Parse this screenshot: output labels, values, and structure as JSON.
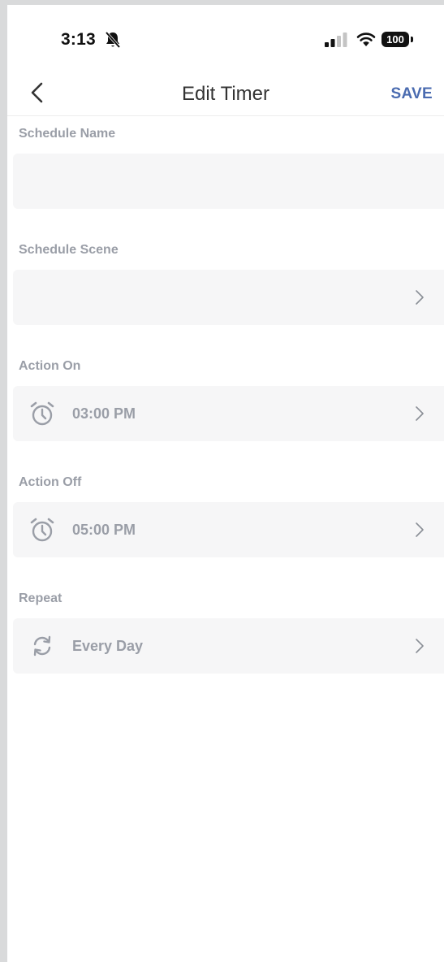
{
  "status_bar": {
    "time": "3:13",
    "battery": "100",
    "icons": [
      "bell-slash-icon",
      "signal-icon",
      "wifi-icon",
      "battery-icon"
    ]
  },
  "nav": {
    "back_icon": "chevron-left-icon",
    "title": "Edit Timer",
    "save_label": "SAVE",
    "accent_color": "#4a6bb0"
  },
  "form": {
    "schedule_name": {
      "label": "Schedule Name",
      "value": ""
    },
    "schedule_scene": {
      "label": "Schedule Scene",
      "value": ""
    },
    "action_on": {
      "label": "Action On",
      "value": "03:00 PM",
      "icon": "alarm-clock-icon"
    },
    "action_off": {
      "label": "Action Off",
      "value": "05:00 PM",
      "icon": "alarm-clock-icon"
    },
    "repeat": {
      "label": "Repeat",
      "value": "Every Day",
      "icon": "repeat-icon"
    }
  }
}
